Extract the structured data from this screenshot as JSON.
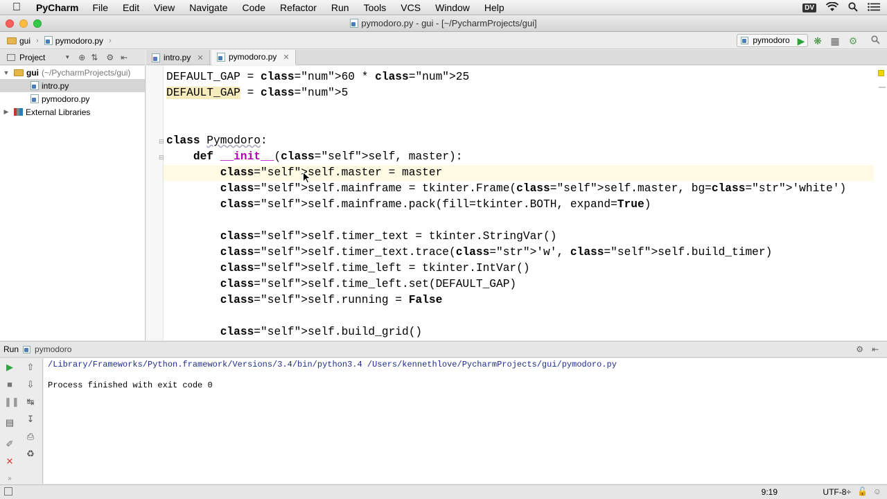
{
  "menubar": {
    "app_name": "PyCharm",
    "items": [
      "File",
      "Edit",
      "View",
      "Navigate",
      "Code",
      "Refactor",
      "Run",
      "Tools",
      "VCS",
      "Window",
      "Help"
    ],
    "status_badge": "DV"
  },
  "window": {
    "title": "pymodoro.py - gui - [~/PycharmProjects/gui]"
  },
  "navbar": {
    "crumb_project": "gui",
    "crumb_file": "pymodoro.py",
    "run_config": "pymodoro"
  },
  "project_panel": {
    "header": "Project",
    "tree": [
      {
        "label": "gui",
        "sub": "(~/PycharmProjects/gui)"
      },
      {
        "label": "intro.py"
      },
      {
        "label": "pymodoro.py"
      },
      {
        "label": "External Libraries"
      }
    ]
  },
  "editor": {
    "tabs": [
      {
        "label": "intro.py"
      },
      {
        "label": "pymodoro.py"
      }
    ],
    "code_lines": [
      "DEFAULT_GAP = 60 * 25",
      "DEFAULT_GAP = 5",
      "",
      "",
      "class Pymodoro:",
      "    def __init__(self, master):",
      "        self.master = master",
      "        self.mainframe = tkinter.Frame(self.master, bg='white')",
      "        self.mainframe.pack(fill=tkinter.BOTH, expand=True)",
      "",
      "        self.timer_text = tkinter.StringVar()",
      "        self.timer_text.trace('w', self.build_timer)",
      "        self.time_left = tkinter.IntVar()",
      "        self.time_left.set(DEFAULT_GAP)",
      "        self.running = False",
      "",
      "        self.build_grid()"
    ]
  },
  "run_panel": {
    "label": "Run",
    "config": "pymodoro",
    "console": [
      "/Library/Frameworks/Python.framework/Versions/3.4/bin/python3.4 /Users/kennethlove/PycharmProjects/gui/pymodoro.py",
      "",
      "Process finished with exit code 0"
    ]
  },
  "statusbar": {
    "position": "9:19",
    "encoding": "UTF-8÷"
  }
}
